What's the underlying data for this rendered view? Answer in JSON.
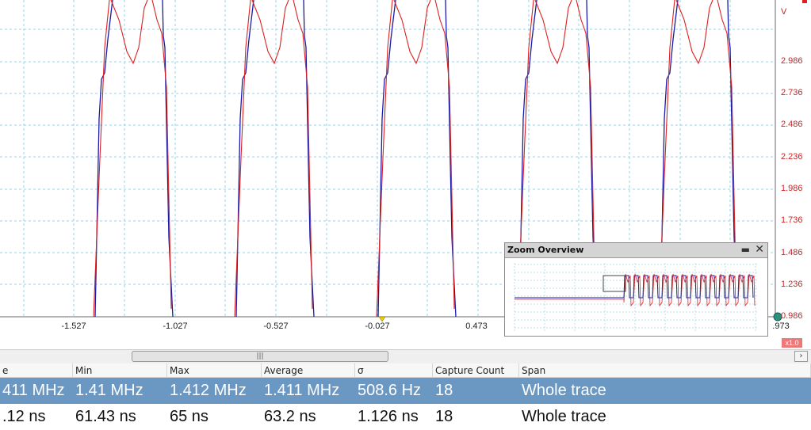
{
  "scope": {
    "x_ticks": [
      "-1.527",
      "-1.027",
      "-0.527",
      "-0.027",
      "0.473",
      ".973"
    ],
    "y_ticks": [
      "V",
      "2.986",
      "2.736",
      "2.486",
      "2.236",
      "1.986",
      "1.736",
      "1.486",
      "1.236",
      "0.986"
    ],
    "colors": {
      "channel_a": "#1a1aa8",
      "channel_b": "#dd2020",
      "grid": "#9fd0e0",
      "axis_text": "#cc2222"
    }
  },
  "zoom_overview": {
    "title": "Zoom Overview",
    "minimize_label": "▬",
    "close_label": "✕",
    "badge": "x1.0"
  },
  "scrollbar": {
    "grip": "|||",
    "right_arrow": "›"
  },
  "table": {
    "columns": [
      "e",
      "Min",
      "Max",
      "Average",
      "σ",
      "Capture Count",
      "Span"
    ],
    "rows": [
      [
        "411 MHz",
        "1.41 MHz",
        "1.412 MHz",
        "1.411 MHz",
        "508.6 Hz",
        "18",
        "Whole trace"
      ],
      [
        ".12 ns",
        "61.43 ns",
        "65 ns",
        "63.2 ns",
        "1.126 ns",
        "18",
        "Whole trace"
      ]
    ]
  }
}
